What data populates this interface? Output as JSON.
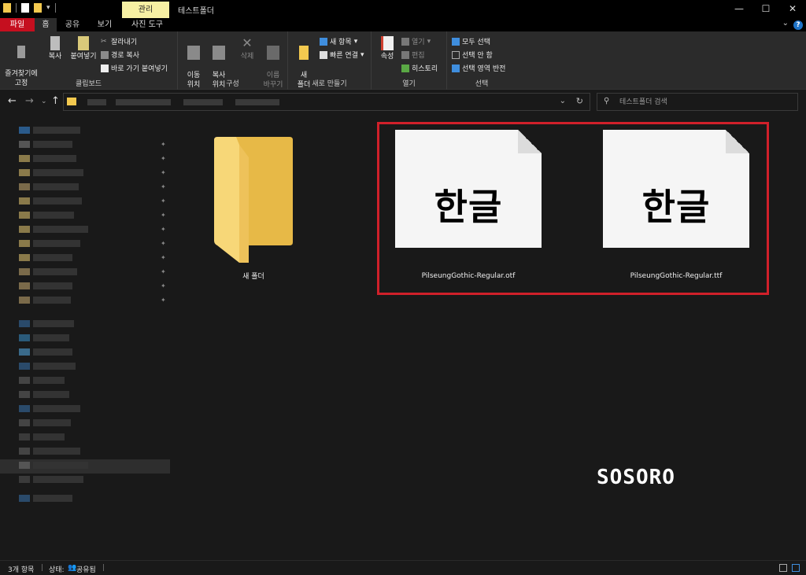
{
  "titlebar": {
    "manage_tab": "관리",
    "title": "테스트폴더",
    "minimize": "—",
    "maximize": "☐",
    "close": "✕"
  },
  "tabs": {
    "file": "파일",
    "home": "홈",
    "share": "공유",
    "view": "보기",
    "picture_tools": "사진 도구"
  },
  "ribbon": {
    "clipboard": {
      "pin_label": "즐겨찾기에\n고정",
      "copy": "복사",
      "paste": "붙여넣기",
      "cut": "잘라내기",
      "copy_path": "경로 복사",
      "paste_shortcut": "바로 가기 붙여넣기",
      "group_label": "클립보드"
    },
    "organize": {
      "move_to": "이동\n위치",
      "copy_to": "복사\n위치",
      "delete": "삭제",
      "rename": "이름\n바꾸기",
      "group_label": "구성"
    },
    "new": {
      "new_folder": "새\n폴더",
      "new_item": "새 항목",
      "easy_access": "빠른 연결",
      "group_label": "새로 만들기"
    },
    "open": {
      "properties": "속성",
      "open": "열기",
      "edit": "편집",
      "history": "히스토리",
      "group_label": "열기"
    },
    "select": {
      "select_all": "모두 선택",
      "select_none": "선택 안 함",
      "invert": "선택 영역 반전",
      "group_label": "선택"
    }
  },
  "search": {
    "placeholder": "테스트폴더 검색"
  },
  "items": [
    {
      "name": "새 폴더",
      "type": "folder"
    },
    {
      "name": "PilseungGothic-Regular.otf",
      "type": "font",
      "preview": "한글"
    },
    {
      "name": "PilseungGothic-Regular.ttf",
      "type": "font",
      "preview": "한글"
    }
  ],
  "watermark": "SOSORO",
  "status": {
    "count": "3개 항목",
    "state_label": "상태:",
    "state_value": "공유됨"
  },
  "colors": {
    "file_tab": "#c50f1f",
    "manage_tab": "#f7f0a3",
    "highlight": "#d0202a",
    "folder": "#f3c94f"
  }
}
